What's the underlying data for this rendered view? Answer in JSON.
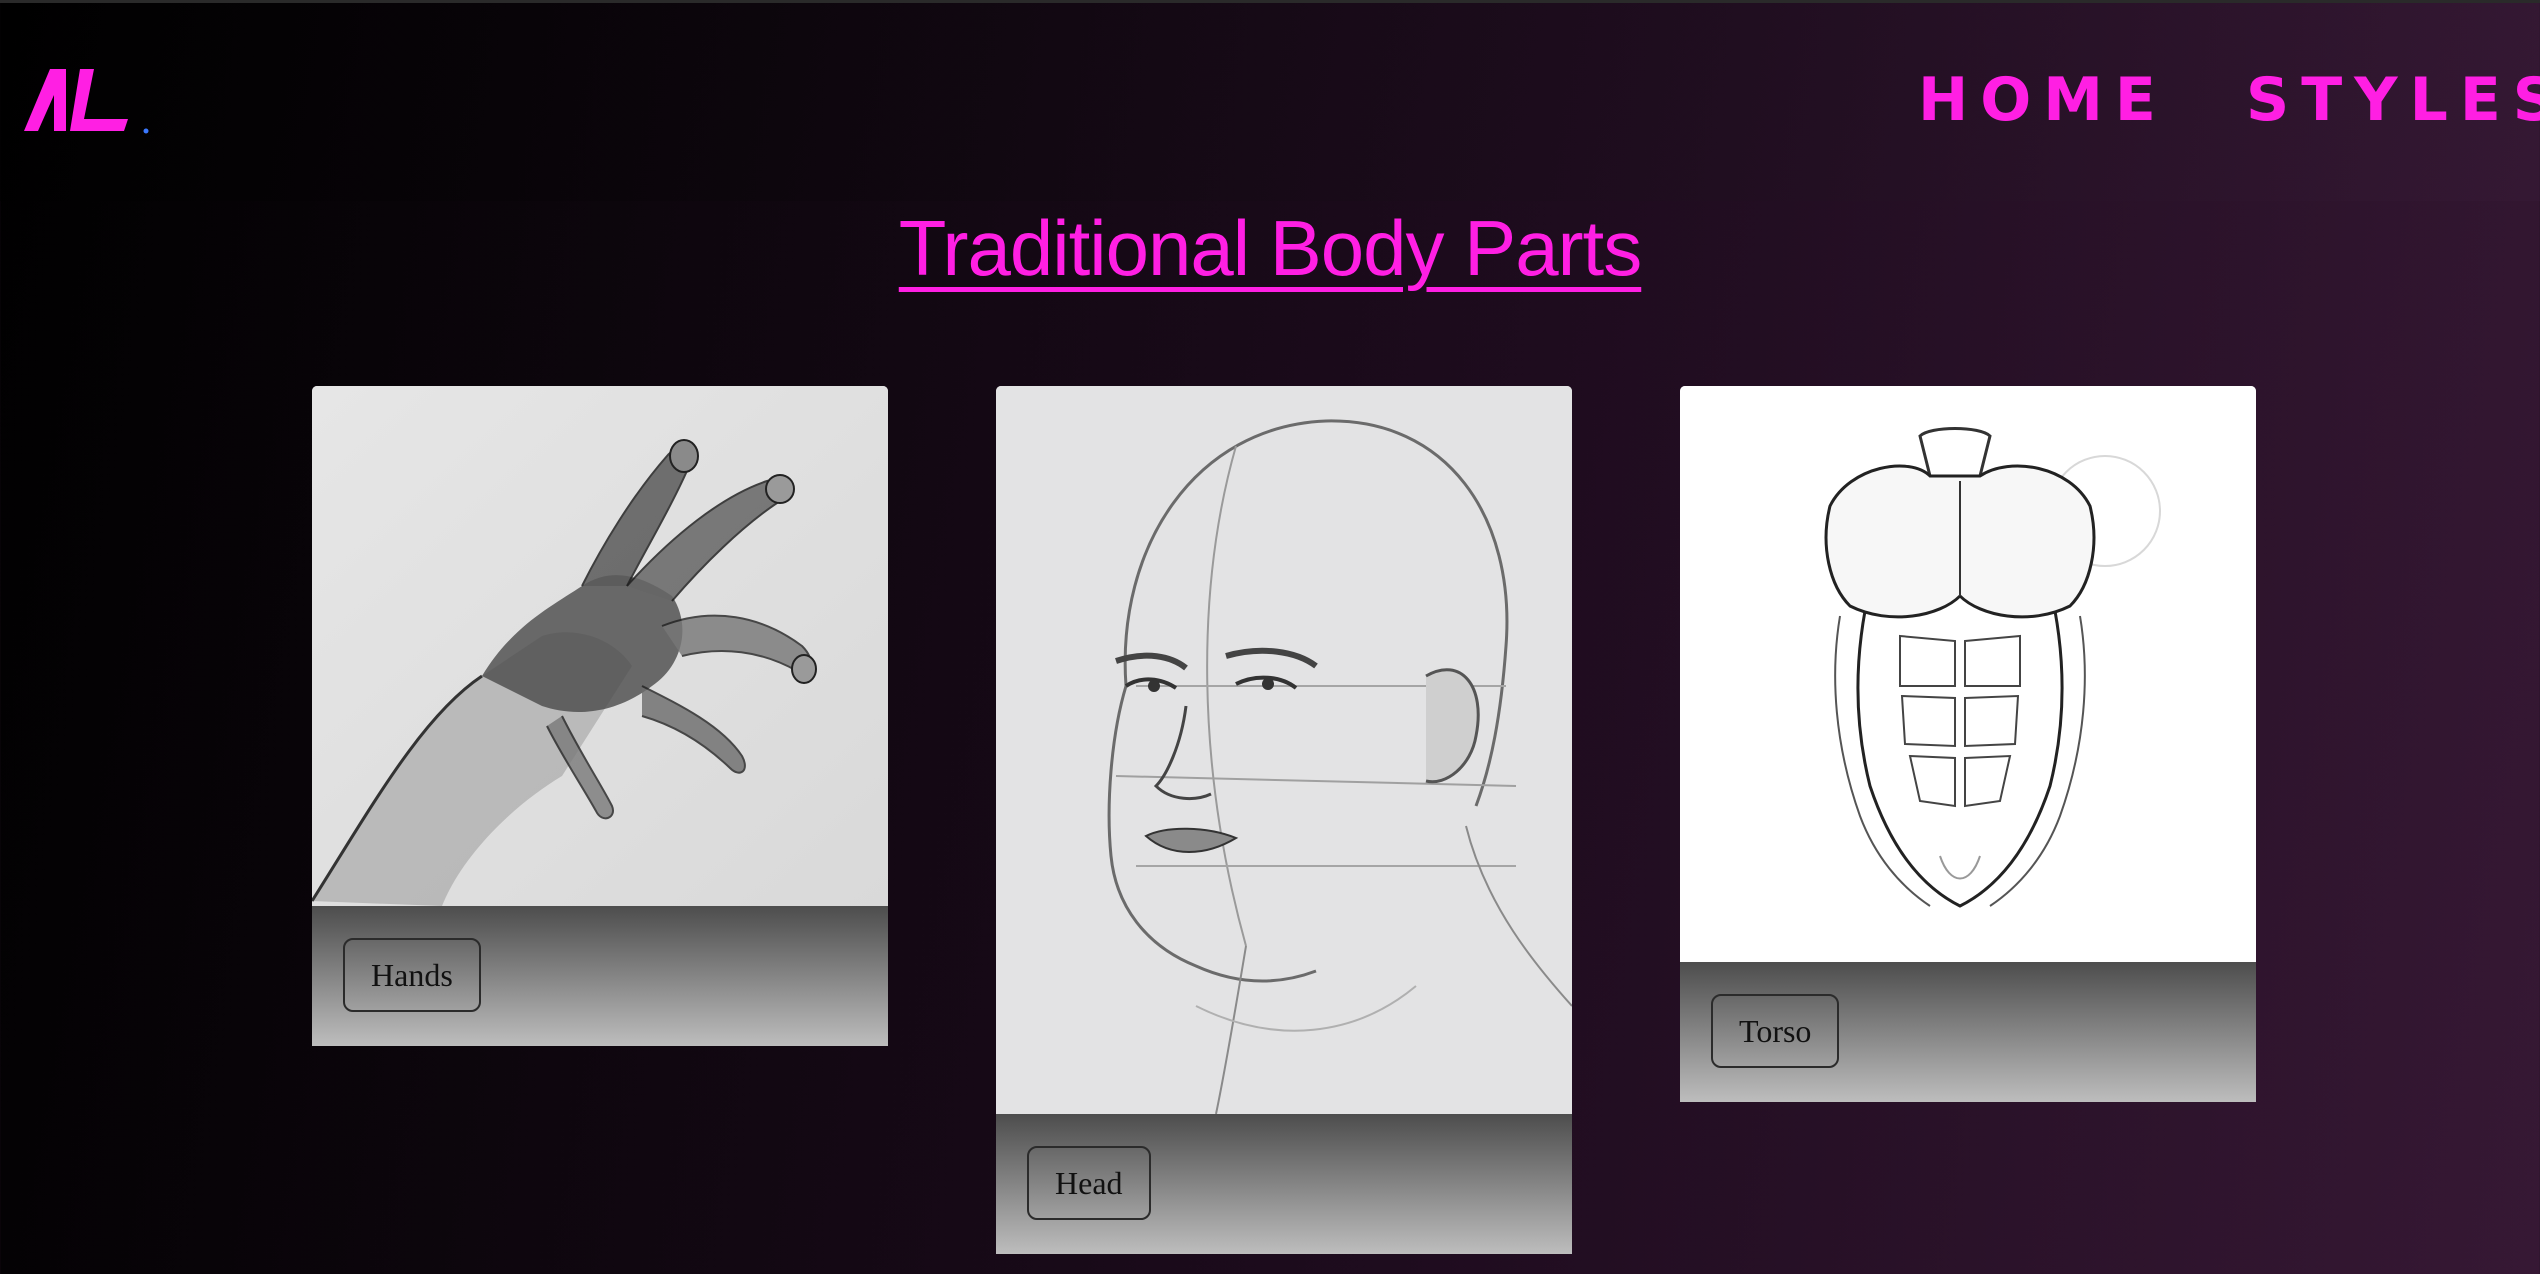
{
  "header": {
    "logo_text": "AL",
    "nav": [
      {
        "label": "HOME"
      },
      {
        "label": "STYLES"
      }
    ]
  },
  "page": {
    "title": "Traditional Body Parts"
  },
  "cards": [
    {
      "label": "Hands",
      "image": "hand-sketch"
    },
    {
      "label": "Head",
      "image": "head-sketch"
    },
    {
      "label": "Torso",
      "image": "torso-sketch"
    }
  ],
  "colors": {
    "accent": "#ff1fe3",
    "background_dark": "#000000",
    "background_purple": "#361834"
  }
}
